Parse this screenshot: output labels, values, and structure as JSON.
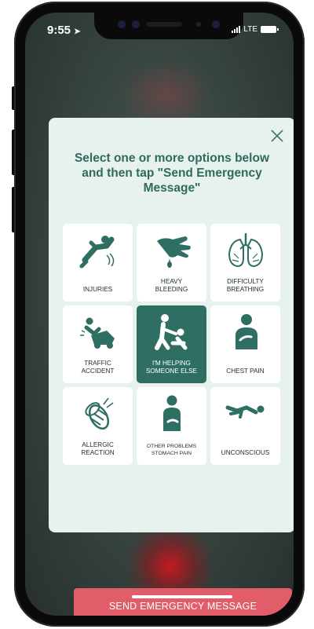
{
  "status_bar": {
    "time": "9:55",
    "network": "LTE"
  },
  "modal": {
    "title": "Select one or more options below and then tap \"Send Emergency Message\"",
    "options": [
      {
        "label": "INJURIES",
        "icon": "injuries-icon",
        "selected": false
      },
      {
        "label": "HEAVY\nBLEEDING",
        "icon": "heavy-bleeding-icon",
        "selected": false
      },
      {
        "label": "DIFFICULTY\nBREATHING",
        "icon": "difficulty-breathing-icon",
        "selected": false
      },
      {
        "label": "TRAFFIC\nACCIDENT",
        "icon": "traffic-accident-icon",
        "selected": false
      },
      {
        "label": "I'M HELPING\nSOMEONE ELSE",
        "icon": "helping-someone-icon",
        "selected": true
      },
      {
        "label": "CHEST PAIN",
        "icon": "chest-pain-icon",
        "selected": false
      },
      {
        "label": "ALLERGIC\nREACTION",
        "icon": "allergic-reaction-icon",
        "selected": false
      },
      {
        "label": "OTHER PROBLEMS\nSTOMACH PAIN",
        "icon": "stomach-pain-icon",
        "selected": false
      },
      {
        "label": "UNCONSCIOUS",
        "icon": "unconscious-icon",
        "selected": false
      }
    ],
    "send_label": "SEND EMERGENCY MESSAGE"
  },
  "colors": {
    "accent_green": "#2e6e63",
    "title_green": "#2e6b5e",
    "send_red": "#e05d69",
    "modal_bg": "#e7f1ee"
  }
}
